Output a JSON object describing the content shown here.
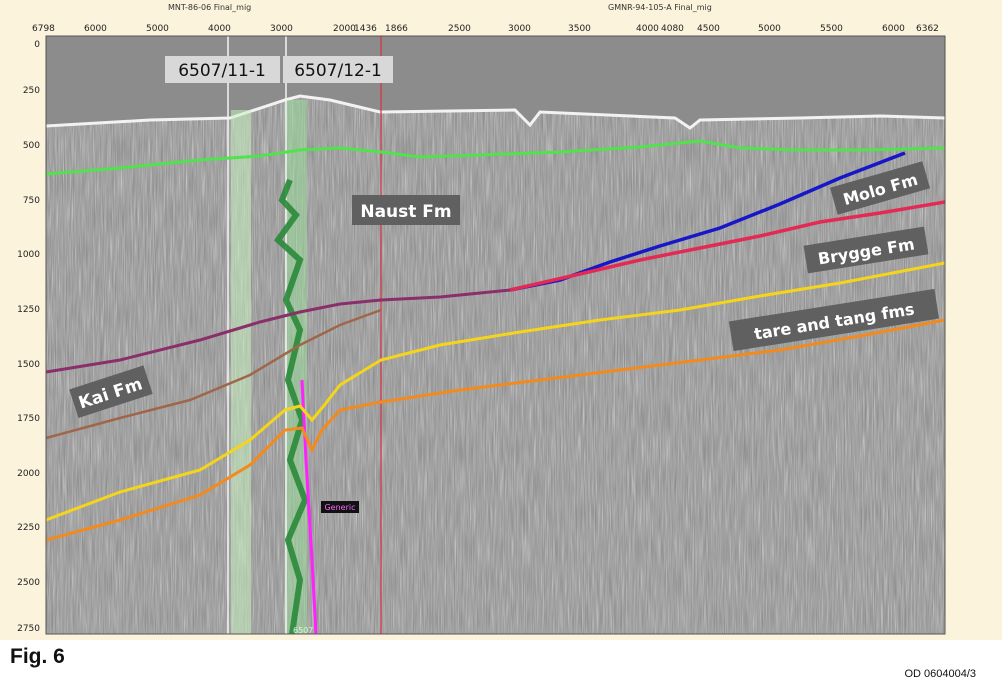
{
  "line_titles": {
    "left": "MNT-86-06  Final_mig",
    "right": "GMNR-94-105-A  Final_mig"
  },
  "top_axis_ticks_left": [
    "6798",
    "6000",
    "5000",
    "4000",
    "3000",
    "2000"
  ],
  "top_axis_ticks_right": [
    "1436",
    "1866",
    "2500",
    "3000",
    "3500",
    "4000",
    "4080",
    "4500",
    "5000",
    "5500",
    "6000",
    "6362"
  ],
  "y_axis_ticks": [
    "0",
    "250",
    "500",
    "750",
    "1000",
    "1250",
    "1500",
    "1750",
    "2000",
    "2250",
    "2500",
    "2750"
  ],
  "wells": [
    "6507/11-1",
    "6507/12-1"
  ],
  "formations": [
    "Naust Fm",
    "Molo Fm",
    "Brygge Fm",
    "tare and tang fms",
    "Kai Fm"
  ],
  "generic_tag": "Generic",
  "well_bottom_tag": "6507",
  "figure_label": "Fig. 6",
  "ref_code": "OD 0604004/3",
  "horizon_colors": {
    "naust": "#52e24e",
    "molo": "#1717c8",
    "brygge": "#e32a55",
    "tare": "#f5d51b",
    "tang": "#f28a1e",
    "kai": "#8a2f6a",
    "kai_base": "#a0664a"
  }
}
